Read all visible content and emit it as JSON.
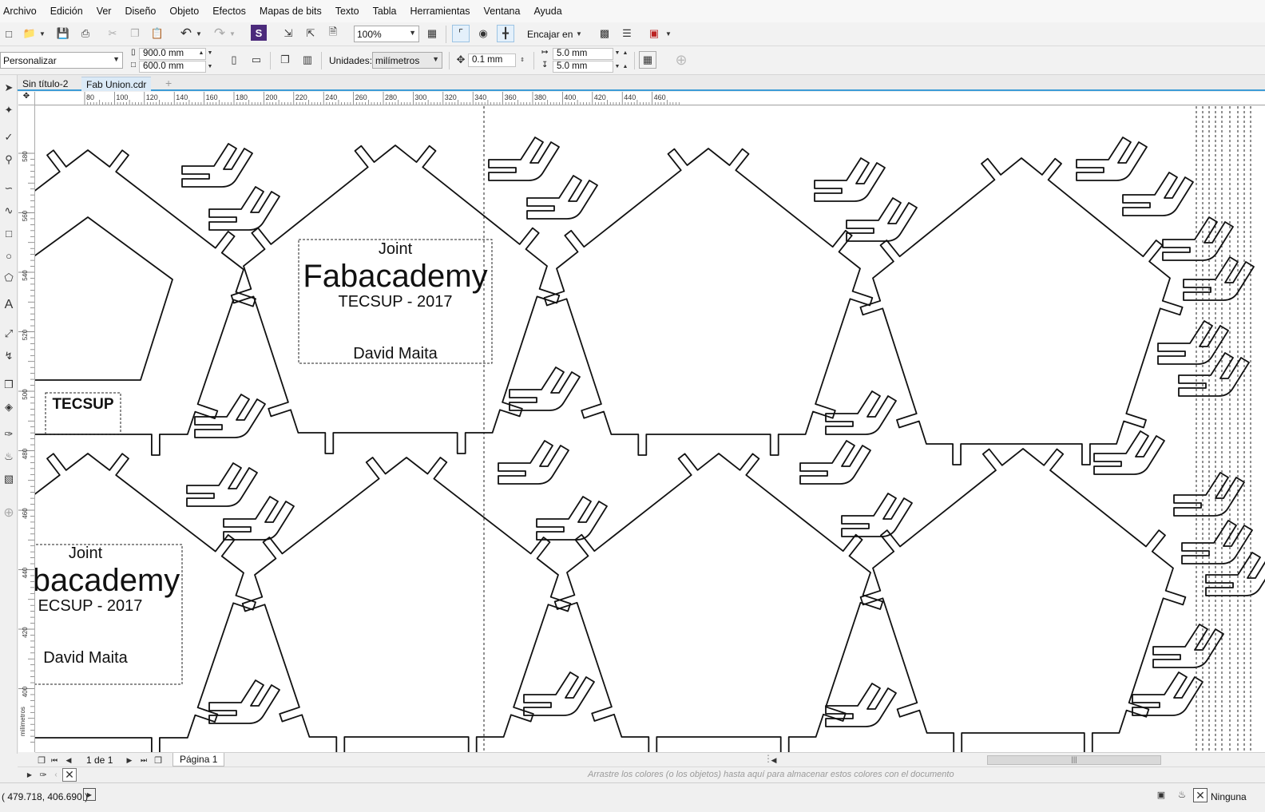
{
  "menu": [
    "Archivo",
    "Edición",
    "Ver",
    "Diseño",
    "Objeto",
    "Efectos",
    "Mapas de bits",
    "Texto",
    "Tabla",
    "Herramientas",
    "Ventana",
    "Ayuda"
  ],
  "toolbar": {
    "zoom": "100%",
    "snap": "Encajar en"
  },
  "props": {
    "preset": "Personalizar",
    "width": "900.0 mm",
    "height": "600.0 mm",
    "units_label": "Unidades:",
    "units": "milímetros",
    "nudge": "0.1 mm",
    "dup_x": "5.0 mm",
    "dup_y": "5.0 mm"
  },
  "tabs": [
    "Sin título-2",
    "Fab Union.cdr"
  ],
  "ruler": {
    "h_ticks": [
      "80",
      "100",
      "120",
      "140",
      "160",
      "180",
      "200",
      "220",
      "240",
      "260",
      "280",
      "300",
      "320",
      "340",
      "360",
      "380",
      "400",
      "420",
      "440",
      "460"
    ],
    "v_ticks": [
      "580",
      "560",
      "540",
      "520",
      "500",
      "480",
      "460",
      "440",
      "420",
      "400"
    ],
    "unit": "milímetros"
  },
  "artwork": {
    "label_top": {
      "joint": "Joint",
      "title": "Fabacademy",
      "sub": "TECSUP - 2017",
      "author": "David Maita"
    },
    "label_bottom": {
      "joint": "Joint",
      "title": "bacademy",
      "sub": "ECSUP - 2017",
      "author": "David Maita"
    },
    "logo_text": "TECSUP"
  },
  "nav": {
    "page_count": "1 de 1",
    "page_tab": "Página 1"
  },
  "palette_hint": "Arrastre los colores (o los objetos) hasta aquí para almacenar estos colores con el documento",
  "status": {
    "coords": "( 479.718, 406.690 )",
    "fill": "Ninguna"
  },
  "colors": {
    "accent": "#3c9bd6",
    "shape_stroke": "#111111"
  }
}
